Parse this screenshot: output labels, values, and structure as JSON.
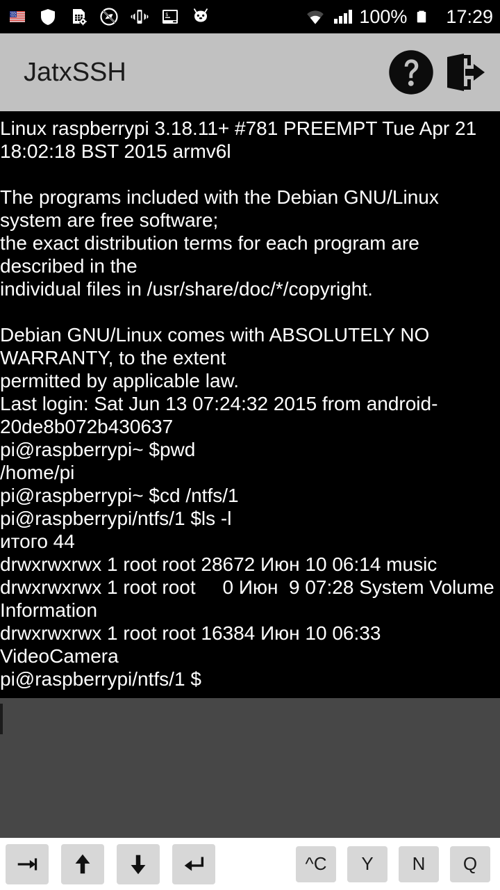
{
  "statusbar": {
    "icons_left": [
      {
        "name": "us-flag-keyboard-icon",
        "label": "US flag"
      },
      {
        "name": "shield-icon",
        "label": "Shield"
      },
      {
        "name": "sim-card-settings-icon",
        "label": "SIM settings"
      },
      {
        "name": "gps-off-icon",
        "label": "GPS off"
      },
      {
        "name": "vibrate-icon",
        "label": "Vibrate"
      },
      {
        "name": "terminal-icon",
        "label": "Terminal"
      },
      {
        "name": "android-head-icon",
        "label": "Android"
      }
    ],
    "wifi_icon": "wifi-icon",
    "signal_icon": "signal-bars-icon",
    "battery_percent": "100%",
    "battery_icon": "battery-full-icon",
    "clock": "17:29"
  },
  "appbar": {
    "title": "JatxSSH",
    "help_icon": "help-circle-icon",
    "help_label": "?",
    "exit_icon": "exit-door-icon"
  },
  "terminal": {
    "output": "Linux raspberrypi 3.18.11+ #781 PREEMPT Tue Apr 21 18:02:18 BST 2015 armv6l\n\nThe programs included with the Debian GNU/Linux system are free software;\nthe exact distribution terms for each program are described in the\nindividual files in /usr/share/doc/*/copyright.\n\nDebian GNU/Linux comes with ABSOLUTELY NO WARRANTY, to the extent\npermitted by applicable law.\nLast login: Sat Jun 13 07:24:32 2015 from android-20de8b072b430637\npi@raspberrypi~ $pwd\n/home/pi\npi@raspberrypi~ $cd /ntfs/1\npi@raspberrypi/ntfs/1 $ls -l\nитого 44\ndrwxrwxrwx 1 root root 28672 Июн 10 06:14 music\ndrwxrwxrwx 1 root root     0 Июн  9 07:28 System Volume Information\ndrwxrwxrwx 1 root root 16384 Июн 10 06:33 VideoCamera\npi@raspberrypi/ntfs/1 $ ",
    "lines": [
      "Linux raspberrypi 3.18.11+ #781 PREEMPT Tue Apr 21 18:02:18 BST 2015 armv6l",
      "",
      "The programs included with the Debian GNU/Linux system are free software;",
      "the exact distribution terms for each program are described in the",
      "individual files in /usr/share/doc/*/copyright.",
      "",
      "Debian GNU/Linux comes with ABSOLUTELY NO WARRANTY, to the extent",
      "permitted by applicable law.",
      "Last login: Sat Jun 13 07:24:32 2015 from android-20de8b072b430637",
      "pi@raspberrypi~ $pwd",
      "/home/pi",
      "pi@raspberrypi~ $cd /ntfs/1",
      "pi@raspberrypi/ntfs/1 $ls -l",
      "итого 44",
      "drwxrwxrwx 1 root root 28672 Июн 10 06:14 music",
      "drwxrwxrwx 1 root root     0 Июн  9 07:28 System Volume Information",
      "drwxrwxrwx 1 root root 16384 Июн 10 06:33 VideoCamera",
      "pi@raspberrypi/ntfs/1 $ "
    ]
  },
  "input": {
    "value": "",
    "placeholder": ""
  },
  "keybar": {
    "left_keys": [
      {
        "name": "tab-key",
        "icon": "tab-icon",
        "label": "Tab"
      },
      {
        "name": "arrow-up-key",
        "icon": "arrow-up-icon",
        "label": "Up"
      },
      {
        "name": "arrow-down-key",
        "icon": "arrow-down-icon",
        "label": "Down"
      },
      {
        "name": "enter-key",
        "icon": "enter-icon",
        "label": "Enter"
      }
    ],
    "right_keys": [
      {
        "name": "ctrl-c-key",
        "label": "^C"
      },
      {
        "name": "y-key",
        "label": "Y"
      },
      {
        "name": "n-key",
        "label": "N"
      },
      {
        "name": "q-key",
        "label": "Q"
      }
    ]
  },
  "colors": {
    "statusbar_bg": "#000000",
    "appbar_bg": "#c1c1c1",
    "terminal_bg": "#000000",
    "terminal_fg": "#ffffff",
    "input_bg": "#474747",
    "keybar_bg": "#ffffff",
    "key_bg": "#d7d7d7",
    "key_fg": "#1b1b1b"
  }
}
